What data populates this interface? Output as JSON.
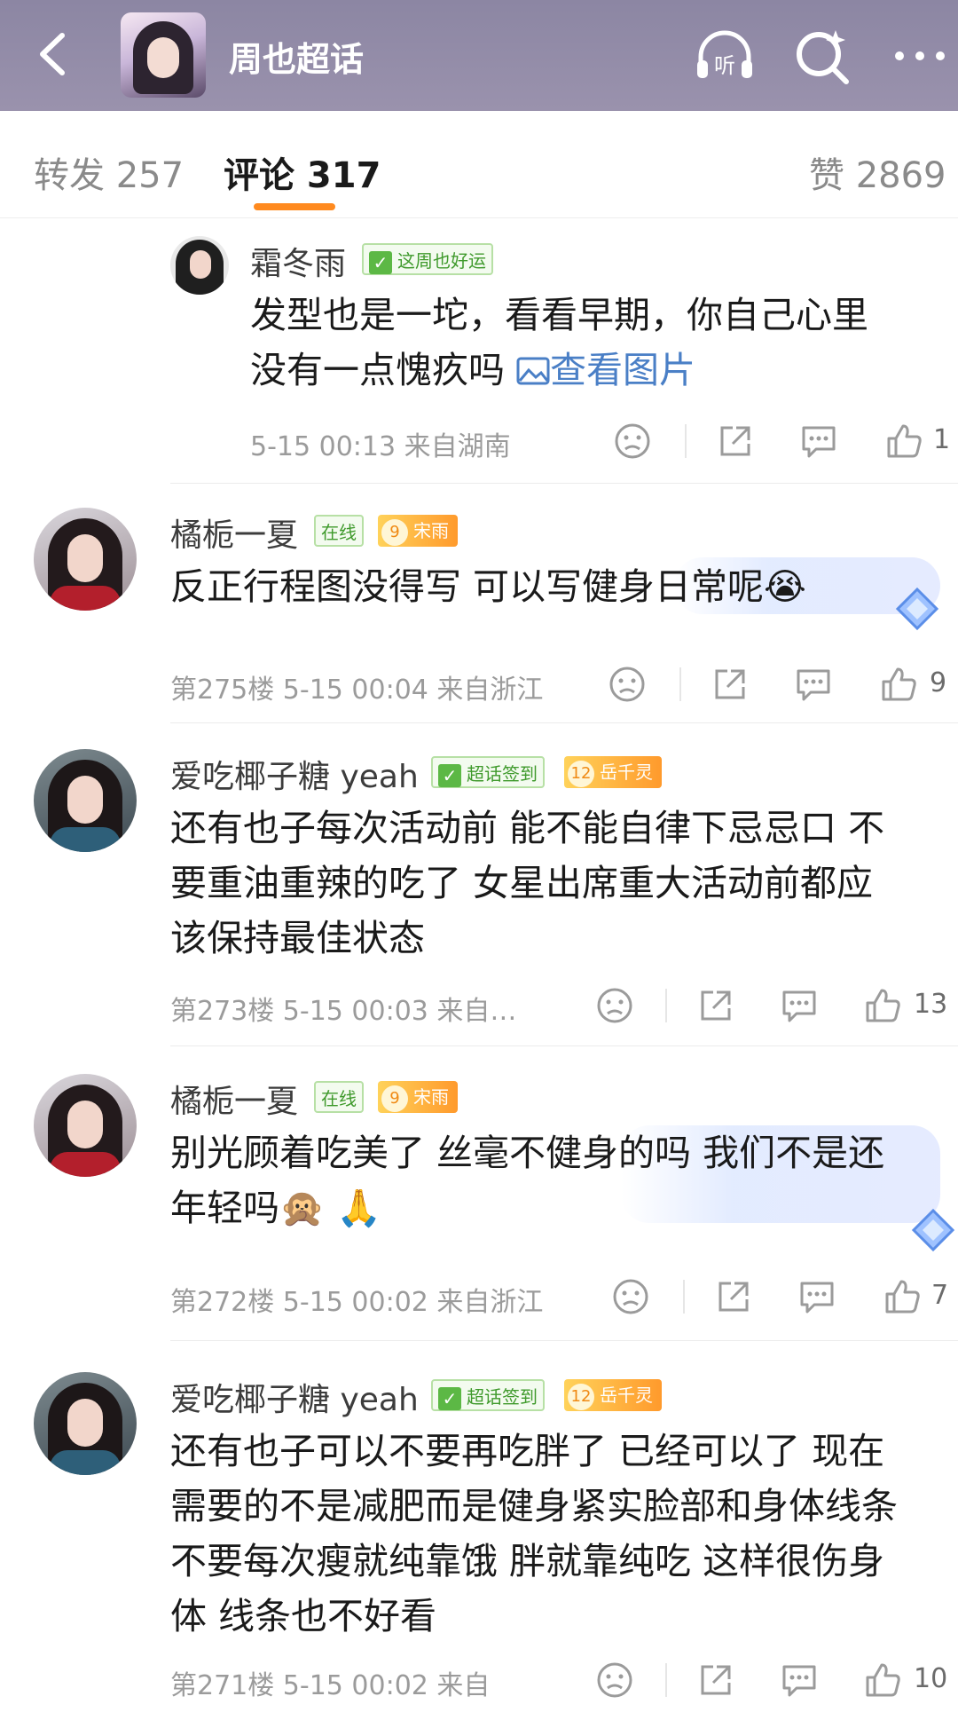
{
  "header": {
    "title": "周也超话",
    "icons": [
      "back-icon",
      "listen-icon",
      "search-icon",
      "more-icon"
    ]
  },
  "tabs": {
    "repost": "转发 257",
    "comments": "评论 317",
    "likes": "赞 2869"
  },
  "comments": [
    {
      "name": "霜冬雨",
      "badges": [
        {
          "type": "green",
          "text": "这周也好运"
        }
      ],
      "lines": [
        "发型也是一坨，看看早期，你自己心里",
        "没有一点愧疚吗"
      ],
      "link": "查看图片",
      "meta": "5-15 00:13 来自湖南",
      "like_count": "1"
    },
    {
      "name": "橘栀一夏",
      "badges": [
        {
          "type": "green",
          "text": "在线"
        },
        {
          "type": "orange",
          "level": "9",
          "text": "宋雨"
        }
      ],
      "lines": [
        "反正行程图没得写 可以写健身日常呢😭"
      ],
      "meta": "第275楼 5-15 00:04 来自浙江",
      "like_count": "9"
    },
    {
      "name": "爱吃椰子糖 yeah",
      "badges": [
        {
          "type": "green",
          "text": "超话签到"
        },
        {
          "type": "orange",
          "level": "12",
          "text": "岳千灵"
        }
      ],
      "lines": [
        "还有也子每次活动前 能不能自律下忌忌口 不",
        "要重油重辣的吃了 女星出席重大活动前都应",
        "该保持最佳状态"
      ],
      "meta": "第273楼 5-15 00:03 来自…",
      "like_count": "13"
    },
    {
      "name": "橘栀一夏",
      "badges": [
        {
          "type": "green",
          "text": "在线"
        },
        {
          "type": "orange",
          "level": "9",
          "text": "宋雨"
        }
      ],
      "lines": [
        "别光顾着吃美了 丝毫不健身的吗 我们不是还",
        "年轻吗🙊 🙏"
      ],
      "meta": "第272楼 5-15 00:02 来自浙江",
      "like_count": "7"
    },
    {
      "name": "爱吃椰子糖 yeah",
      "badges": [
        {
          "type": "green",
          "text": "超话签到"
        },
        {
          "type": "orange",
          "level": "12",
          "text": "岳千灵"
        }
      ],
      "lines": [
        "还有也子可以不要再吃胖了 已经可以了 现在",
        "需要的不是减肥而是健身紧实脸部和身体线条",
        "不要每次瘦就纯靠饿 胖就靠纯吃 这样很伤身",
        "体 线条也不好看"
      ],
      "meta": "第271楼 5-15 00:02 来自",
      "like_count": "10"
    }
  ],
  "colors": {
    "header_bg": "#8c86a3",
    "tab_underline": "#ff8a1f",
    "link": "#4a7fc6",
    "badge_green": "#5cb845",
    "badge_orange": "#ff9a2c"
  }
}
